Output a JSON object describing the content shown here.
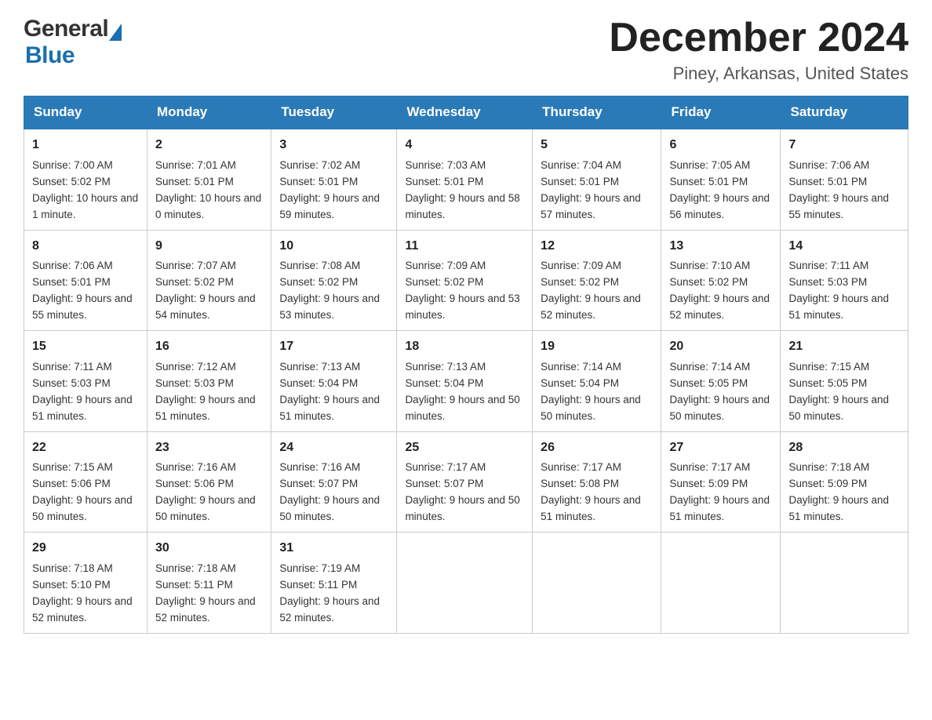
{
  "logo": {
    "general": "General",
    "blue": "Blue"
  },
  "title": "December 2024",
  "subtitle": "Piney, Arkansas, United States",
  "days": [
    "Sunday",
    "Monday",
    "Tuesday",
    "Wednesday",
    "Thursday",
    "Friday",
    "Saturday"
  ],
  "weeks": [
    [
      {
        "num": "1",
        "sunrise": "7:00 AM",
        "sunset": "5:02 PM",
        "daylight": "10 hours and 1 minute."
      },
      {
        "num": "2",
        "sunrise": "7:01 AM",
        "sunset": "5:01 PM",
        "daylight": "10 hours and 0 minutes."
      },
      {
        "num": "3",
        "sunrise": "7:02 AM",
        "sunset": "5:01 PM",
        "daylight": "9 hours and 59 minutes."
      },
      {
        "num": "4",
        "sunrise": "7:03 AM",
        "sunset": "5:01 PM",
        "daylight": "9 hours and 58 minutes."
      },
      {
        "num": "5",
        "sunrise": "7:04 AM",
        "sunset": "5:01 PM",
        "daylight": "9 hours and 57 minutes."
      },
      {
        "num": "6",
        "sunrise": "7:05 AM",
        "sunset": "5:01 PM",
        "daylight": "9 hours and 56 minutes."
      },
      {
        "num": "7",
        "sunrise": "7:06 AM",
        "sunset": "5:01 PM",
        "daylight": "9 hours and 55 minutes."
      }
    ],
    [
      {
        "num": "8",
        "sunrise": "7:06 AM",
        "sunset": "5:01 PM",
        "daylight": "9 hours and 55 minutes."
      },
      {
        "num": "9",
        "sunrise": "7:07 AM",
        "sunset": "5:02 PM",
        "daylight": "9 hours and 54 minutes."
      },
      {
        "num": "10",
        "sunrise": "7:08 AM",
        "sunset": "5:02 PM",
        "daylight": "9 hours and 53 minutes."
      },
      {
        "num": "11",
        "sunrise": "7:09 AM",
        "sunset": "5:02 PM",
        "daylight": "9 hours and 53 minutes."
      },
      {
        "num": "12",
        "sunrise": "7:09 AM",
        "sunset": "5:02 PM",
        "daylight": "9 hours and 52 minutes."
      },
      {
        "num": "13",
        "sunrise": "7:10 AM",
        "sunset": "5:02 PM",
        "daylight": "9 hours and 52 minutes."
      },
      {
        "num": "14",
        "sunrise": "7:11 AM",
        "sunset": "5:03 PM",
        "daylight": "9 hours and 51 minutes."
      }
    ],
    [
      {
        "num": "15",
        "sunrise": "7:11 AM",
        "sunset": "5:03 PM",
        "daylight": "9 hours and 51 minutes."
      },
      {
        "num": "16",
        "sunrise": "7:12 AM",
        "sunset": "5:03 PM",
        "daylight": "9 hours and 51 minutes."
      },
      {
        "num": "17",
        "sunrise": "7:13 AM",
        "sunset": "5:04 PM",
        "daylight": "9 hours and 51 minutes."
      },
      {
        "num": "18",
        "sunrise": "7:13 AM",
        "sunset": "5:04 PM",
        "daylight": "9 hours and 50 minutes."
      },
      {
        "num": "19",
        "sunrise": "7:14 AM",
        "sunset": "5:04 PM",
        "daylight": "9 hours and 50 minutes."
      },
      {
        "num": "20",
        "sunrise": "7:14 AM",
        "sunset": "5:05 PM",
        "daylight": "9 hours and 50 minutes."
      },
      {
        "num": "21",
        "sunrise": "7:15 AM",
        "sunset": "5:05 PM",
        "daylight": "9 hours and 50 minutes."
      }
    ],
    [
      {
        "num": "22",
        "sunrise": "7:15 AM",
        "sunset": "5:06 PM",
        "daylight": "9 hours and 50 minutes."
      },
      {
        "num": "23",
        "sunrise": "7:16 AM",
        "sunset": "5:06 PM",
        "daylight": "9 hours and 50 minutes."
      },
      {
        "num": "24",
        "sunrise": "7:16 AM",
        "sunset": "5:07 PM",
        "daylight": "9 hours and 50 minutes."
      },
      {
        "num": "25",
        "sunrise": "7:17 AM",
        "sunset": "5:07 PM",
        "daylight": "9 hours and 50 minutes."
      },
      {
        "num": "26",
        "sunrise": "7:17 AM",
        "sunset": "5:08 PM",
        "daylight": "9 hours and 51 minutes."
      },
      {
        "num": "27",
        "sunrise": "7:17 AM",
        "sunset": "5:09 PM",
        "daylight": "9 hours and 51 minutes."
      },
      {
        "num": "28",
        "sunrise": "7:18 AM",
        "sunset": "5:09 PM",
        "daylight": "9 hours and 51 minutes."
      }
    ],
    [
      {
        "num": "29",
        "sunrise": "7:18 AM",
        "sunset": "5:10 PM",
        "daylight": "9 hours and 52 minutes."
      },
      {
        "num": "30",
        "sunrise": "7:18 AM",
        "sunset": "5:11 PM",
        "daylight": "9 hours and 52 minutes."
      },
      {
        "num": "31",
        "sunrise": "7:19 AM",
        "sunset": "5:11 PM",
        "daylight": "9 hours and 52 minutes."
      },
      null,
      null,
      null,
      null
    ]
  ],
  "labels": {
    "sunrise": "Sunrise:",
    "sunset": "Sunset:",
    "daylight": "Daylight:"
  }
}
